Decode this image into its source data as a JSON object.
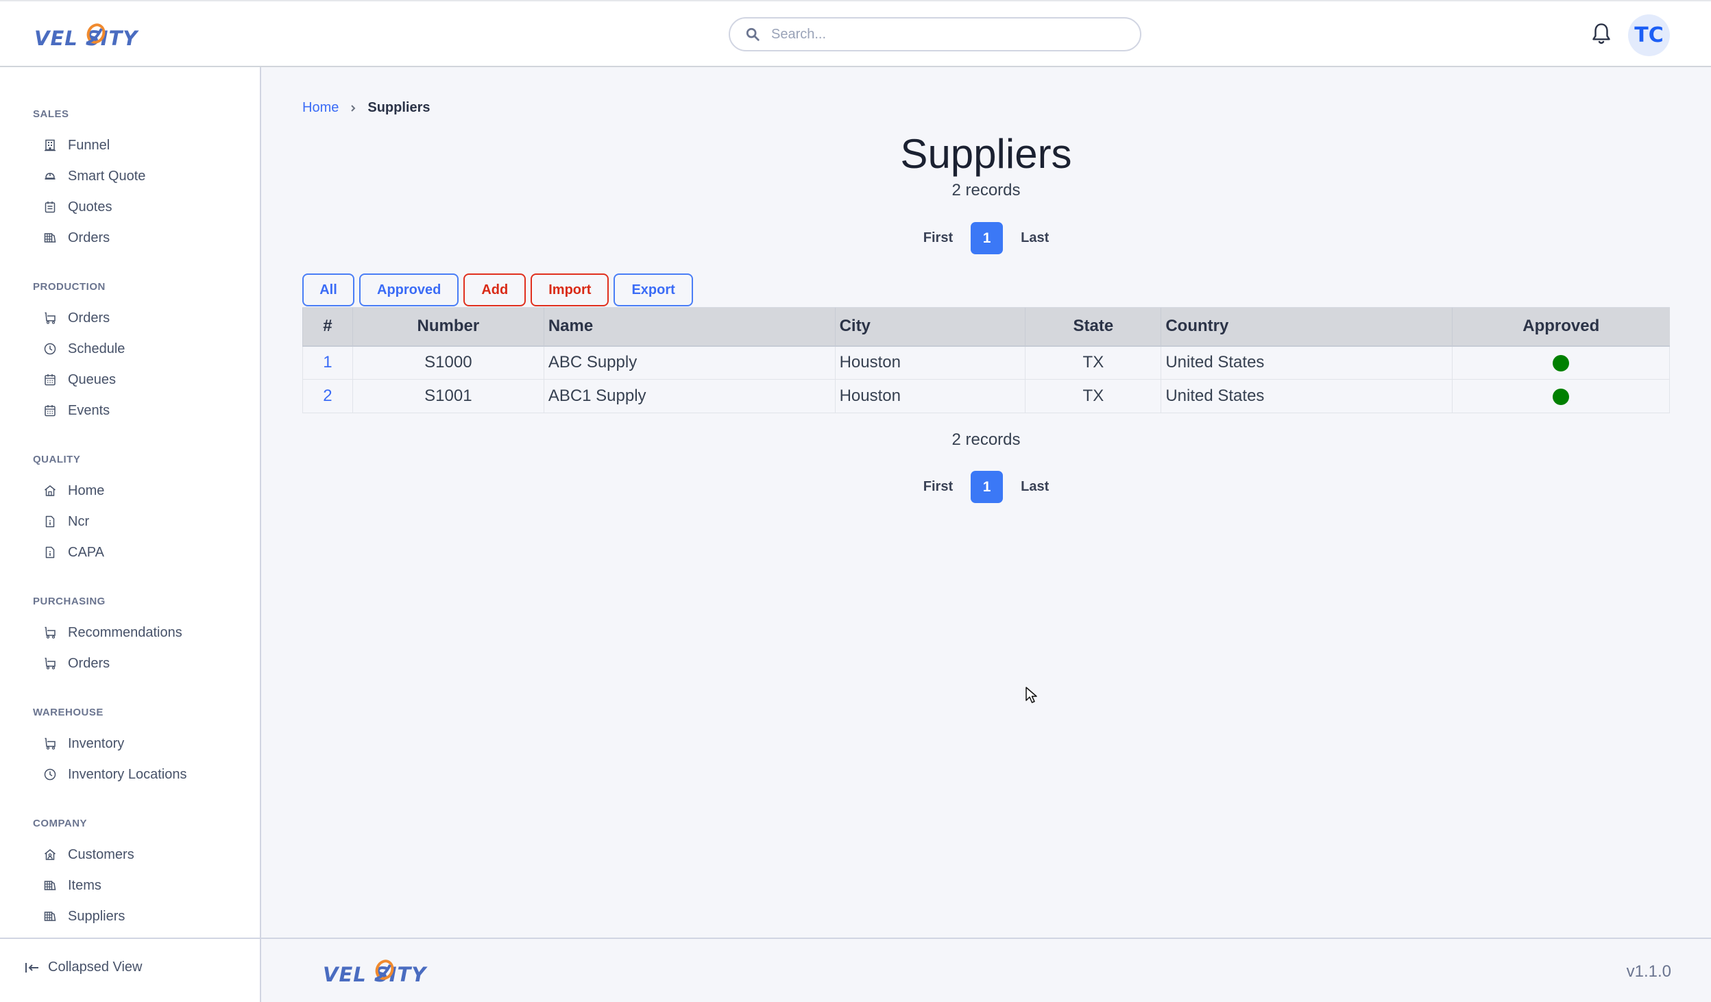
{
  "app": {
    "brand": "VELOSITY",
    "brand_colors": {
      "primary": "#4a6cc0",
      "accent": "#f08a2e"
    },
    "version": "v1.1.0"
  },
  "header": {
    "search_placeholder": "Search...",
    "notifications_icon": "bell-icon",
    "avatar_initials": "TC"
  },
  "sidebar": {
    "sections": [
      {
        "title": "SALES",
        "items": [
          {
            "label": "Funnel",
            "icon": "building-icon"
          },
          {
            "label": "Smart Quote",
            "icon": "hard-hat-icon"
          },
          {
            "label": "Quotes",
            "icon": "clipboard-icon"
          },
          {
            "label": "Orders",
            "icon": "grid-book-icon"
          }
        ]
      },
      {
        "title": "PRODUCTION",
        "items": [
          {
            "label": "Orders",
            "icon": "cart-icon"
          },
          {
            "label": "Schedule",
            "icon": "clock-icon"
          },
          {
            "label": "Queues",
            "icon": "calendar-icon"
          },
          {
            "label": "Events",
            "icon": "calendar-icon"
          }
        ]
      },
      {
        "title": "QUALITY",
        "items": [
          {
            "label": "Home",
            "icon": "home-icon"
          },
          {
            "label": "Ncr",
            "icon": "file-info-icon"
          },
          {
            "label": "CAPA",
            "icon": "file-info-icon"
          }
        ]
      },
      {
        "title": "PURCHASING",
        "items": [
          {
            "label": "Recommendations",
            "icon": "cart-icon"
          },
          {
            "label": "Orders",
            "icon": "cart-icon"
          }
        ]
      },
      {
        "title": "WAREHOUSE",
        "items": [
          {
            "label": "Inventory",
            "icon": "cart-icon"
          },
          {
            "label": "Inventory Locations",
            "icon": "clock-icon"
          }
        ]
      },
      {
        "title": "COMPANY",
        "items": [
          {
            "label": "Customers",
            "icon": "home-user-icon"
          },
          {
            "label": "Items",
            "icon": "grid-book-icon"
          },
          {
            "label": "Suppliers",
            "icon": "grid-book-icon"
          }
        ]
      }
    ],
    "collapse_label": "Collapsed View"
  },
  "breadcrumb": {
    "home": "Home",
    "current": "Suppliers"
  },
  "page": {
    "title": "Suppliers",
    "records_label": "2 records",
    "pager": {
      "first": "First",
      "current_page": "1",
      "last": "Last"
    }
  },
  "actions": {
    "all": "All",
    "approved": "Approved",
    "add": "Add",
    "import": "Import",
    "export": "Export"
  },
  "table": {
    "columns": [
      "#",
      "Number",
      "Name",
      "City",
      "State",
      "Country",
      "Approved"
    ],
    "rows": [
      {
        "index": "1",
        "number": "S1000",
        "name": "ABC Supply",
        "city": "Houston",
        "state": "TX",
        "country": "United States",
        "approved": true
      },
      {
        "index": "2",
        "number": "S1001",
        "name": "ABC1 Supply",
        "city": "Houston",
        "state": "TX",
        "country": "United States",
        "approved": true
      }
    ],
    "approved_color": "#008000"
  }
}
